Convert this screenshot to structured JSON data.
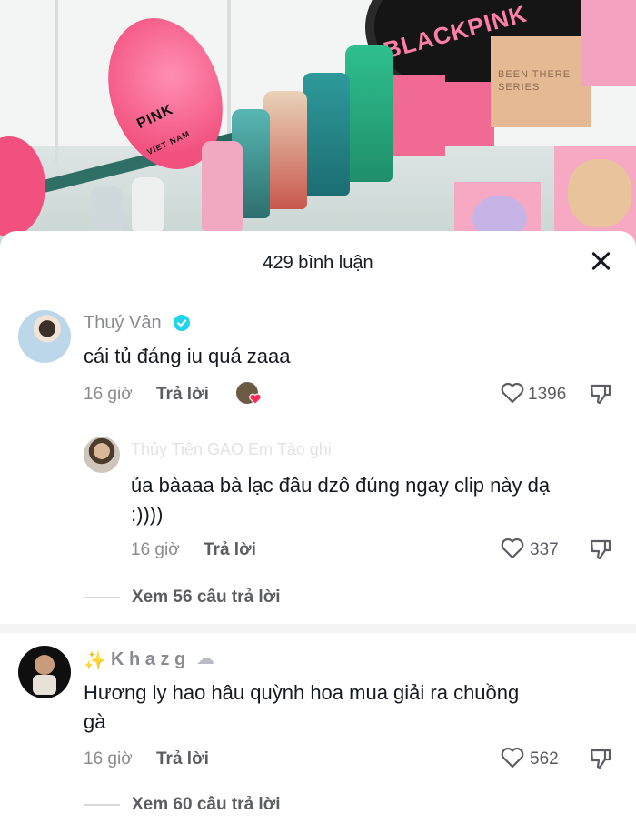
{
  "video": {
    "hat_text_left": "PINK",
    "hat_text_left_sub": "VIET NAM",
    "hat_text_top": "BLACKPINK",
    "box_text": "BEEN THERE SERIES"
  },
  "header": {
    "title": "429 bình luận"
  },
  "comments": [
    {
      "username": "Thuý Vân",
      "verified": true,
      "text": "cái tủ đáng iu quá zaaa",
      "time": "16 giờ",
      "reply_label": "Trả lời",
      "likes": "1396",
      "replies": [
        {
          "username_faded": "Thủy Tiên GAO Em Tào ghi",
          "text_line1": "ủa bàaaa bà lạc đâu dzô đúng ngay clip này dạ",
          "text_line2": ":))))",
          "time": "16 giờ",
          "reply_label": "Trả lời",
          "likes": "337"
        }
      ],
      "view_more": "Xem 56 câu trả lời"
    },
    {
      "username": "K h a z g",
      "username_prefix": "✨",
      "username_suffix": "☁",
      "text_line1": "Hương ly hao hâu quỳnh hoa mua giải ra chuồng",
      "text_line2": "gà",
      "time": "16 giờ",
      "reply_label": "Trả lời",
      "likes": "562",
      "view_more": "Xem 60 câu trả lời"
    }
  ],
  "colors": {
    "verified": "#20d5ec",
    "creator_heart": "#fe2c55"
  }
}
